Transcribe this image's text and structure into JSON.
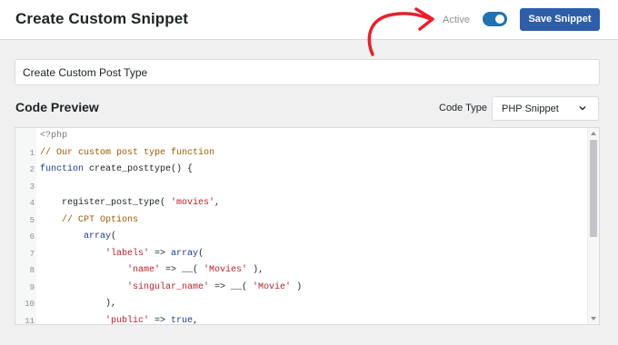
{
  "header": {
    "title": "Create Custom Snippet",
    "status_label": "Active",
    "active": true,
    "save_label": "Save Snippet"
  },
  "title_input": {
    "value": "Create Custom Post Type"
  },
  "code_section": {
    "title": "Code Preview",
    "code_type_label": "Code Type",
    "code_type_value": "PHP Snippet"
  },
  "code_lines": [
    {
      "num": "",
      "text": "<?php"
    },
    {
      "num": "1",
      "text": "// Our custom post type function"
    },
    {
      "num": "2",
      "text": "function create_posttype() {"
    },
    {
      "num": "3",
      "text": ""
    },
    {
      "num": "4",
      "text": "    register_post_type( 'movies',"
    },
    {
      "num": "5",
      "text": "    // CPT Options"
    },
    {
      "num": "6",
      "text": "        array("
    },
    {
      "num": "7",
      "text": "            'labels' => array("
    },
    {
      "num": "8",
      "text": "                'name' => __( 'Movies' ),"
    },
    {
      "num": "9",
      "text": "                'singular_name' => __( 'Movie' )"
    },
    {
      "num": "10",
      "text": "            ),"
    },
    {
      "num": "11",
      "text": "            'public' => true,"
    }
  ],
  "colors": {
    "accent": "#2271b1",
    "save_button": "#2e5ea8",
    "annotation_arrow": "#e8202a"
  },
  "icons": {
    "annotation": "curved-arrow-icon",
    "dropdown": "chevron-down-icon"
  }
}
